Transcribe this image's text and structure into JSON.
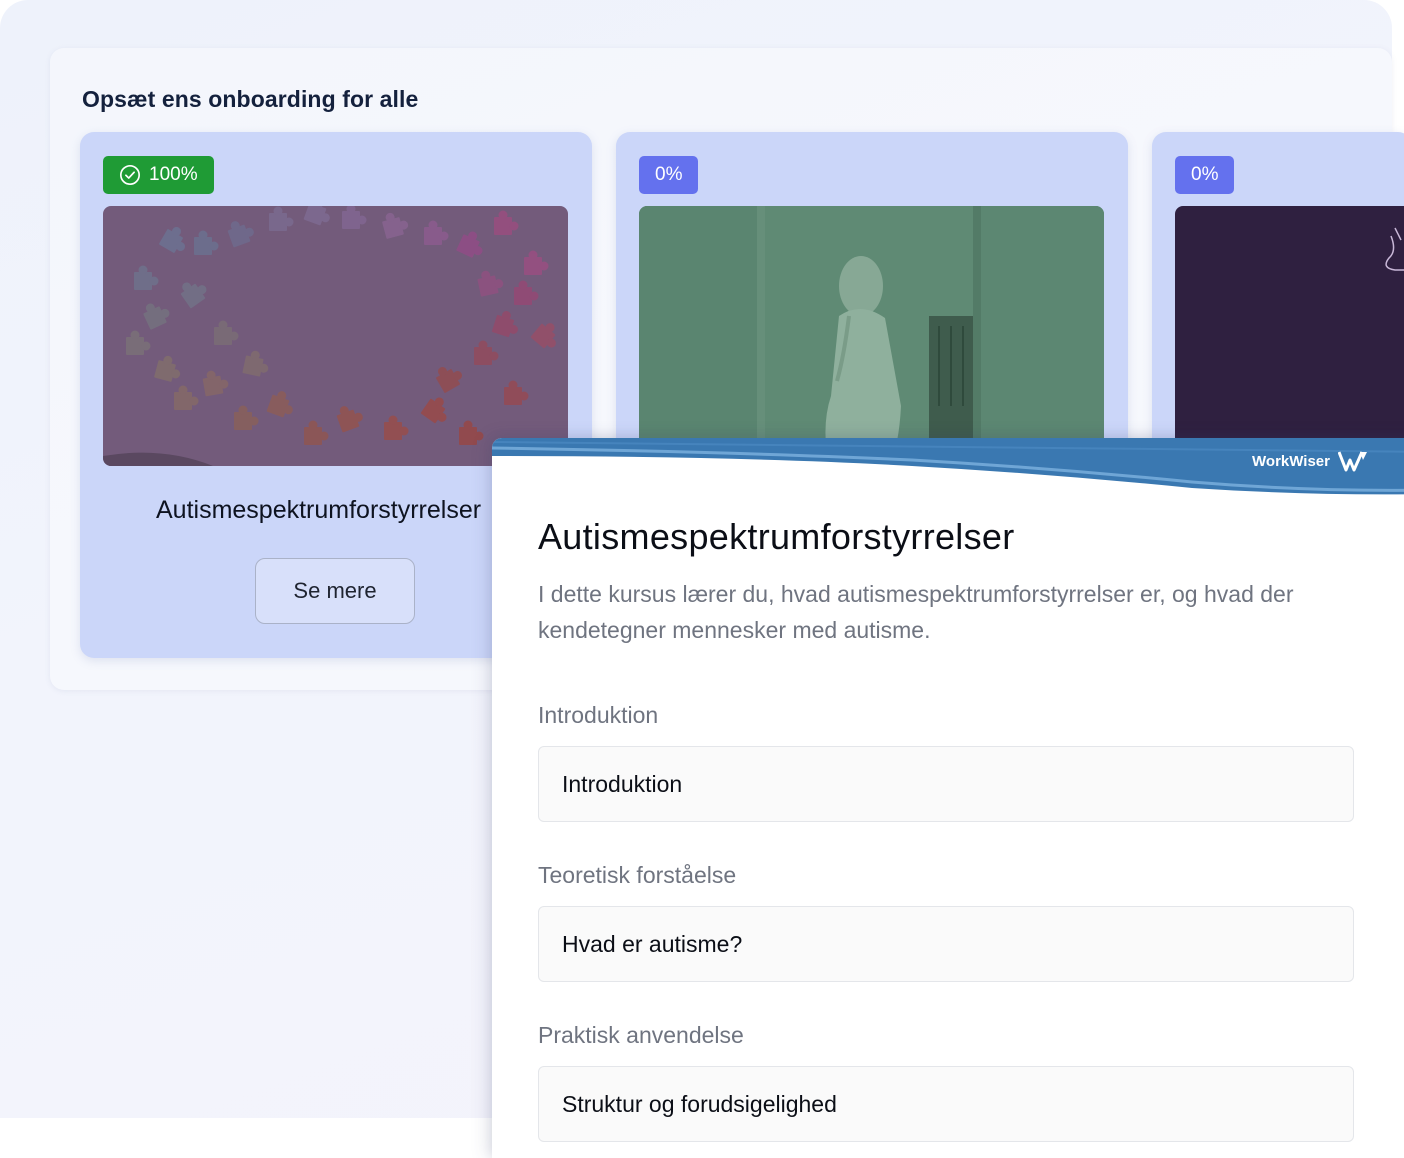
{
  "panel": {
    "title": "Opsæt ens onboarding for alle"
  },
  "cards": [
    {
      "badge": "100%",
      "badge_icon": "check-circle-icon",
      "badge_color": "#1f9b35",
      "title": "Autismespektrumforstyrrelser",
      "button": "Se mere"
    },
    {
      "badge": "0%",
      "badge_color": "#6471ee"
    },
    {
      "badge": "0%",
      "badge_color": "#6471ee"
    }
  ],
  "detail": {
    "brand": "WorkWiser",
    "brand_icon": "workwiser-logo-icon",
    "header_color": "#3c7cb5",
    "title": "Autismespektrumforstyrrelser",
    "description": "I dette kursus lærer du, hvad autismespektrumforstyrrelser er, og hvad der kendetegner mennesker med autisme.",
    "sections": [
      {
        "label": "Introduktion",
        "lesson": "Introduktion"
      },
      {
        "label": "Teoretisk forståelse",
        "lesson": "Hvad er autisme?"
      },
      {
        "label": "Praktisk anvendelse",
        "lesson": "Struktur og forudsigelighed"
      }
    ]
  }
}
